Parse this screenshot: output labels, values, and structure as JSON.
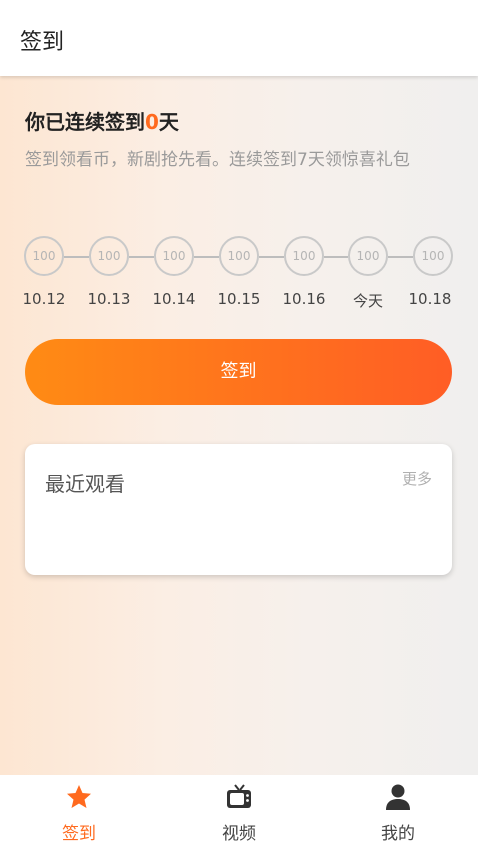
{
  "header": {
    "title": "签到"
  },
  "main": {
    "streak_prefix": "你已连续签到",
    "streak_count": "0",
    "streak_suffix": "天",
    "description": "签到领看币，新剧抢先看。连续签到7天领惊喜礼包",
    "days": [
      {
        "coins": "100",
        "label": "10.12"
      },
      {
        "coins": "100",
        "label": "10.13"
      },
      {
        "coins": "100",
        "label": "10.14"
      },
      {
        "coins": "100",
        "label": "10.15"
      },
      {
        "coins": "100",
        "label": "10.16"
      },
      {
        "coins": "100",
        "label": "今天"
      },
      {
        "coins": "100",
        "label": "10.18"
      }
    ],
    "sign_button": "签到",
    "recent": {
      "title": "最近观看",
      "more": "更多"
    }
  },
  "tabbar": {
    "items": [
      {
        "label": "签到",
        "icon": "star-icon",
        "active": true
      },
      {
        "label": "视频",
        "icon": "tv-icon",
        "active": false
      },
      {
        "label": "我的",
        "icon": "user-icon",
        "active": false
      }
    ]
  },
  "colors": {
    "accent": "#ff6a1e",
    "button_start": "#ff8b14",
    "button_end": "#ff5d25"
  }
}
